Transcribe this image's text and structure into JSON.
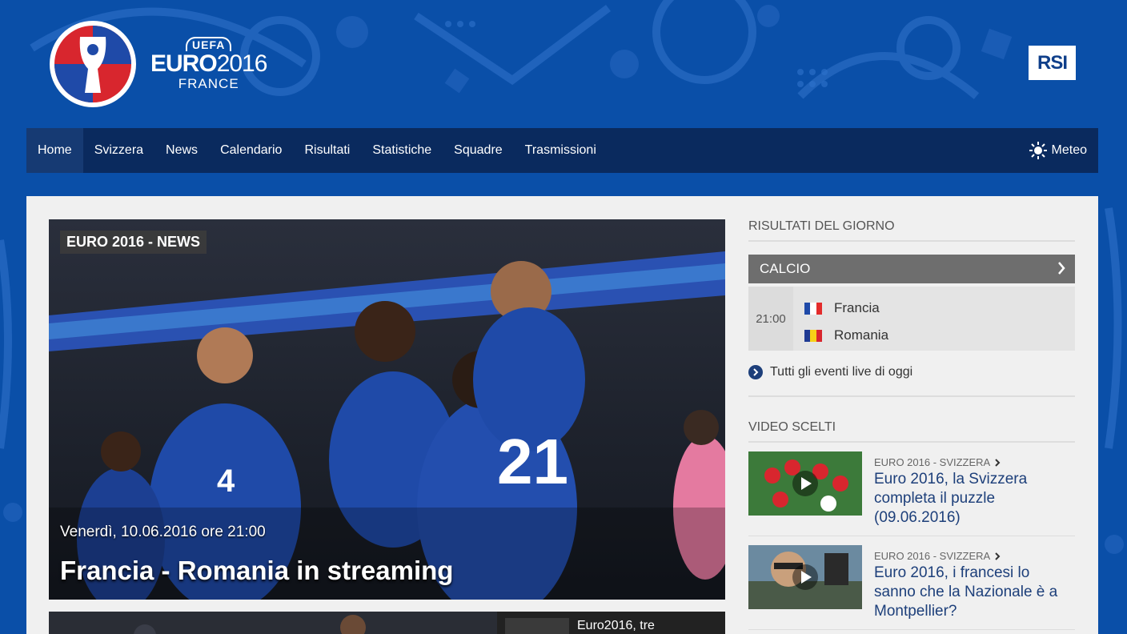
{
  "header": {
    "brand_uefa": "UEFA",
    "brand_euro": "EURO",
    "brand_year": "2016",
    "brand_country": "FRANCE",
    "broadcaster": "RSI"
  },
  "nav": {
    "items": [
      "Home",
      "Svizzera",
      "News",
      "Calendario",
      "Risultati",
      "Statistiche",
      "Squadre",
      "Trasmissioni"
    ],
    "active_index": 0,
    "meteo_label": "Meteo"
  },
  "hero": {
    "tag": "EURO 2016 - NEWS",
    "date": "Venerdì, 10.06.2016 ore 21:00",
    "title": "Francia - Romania in streaming",
    "jersey_number": "21",
    "jersey_number_2": "4"
  },
  "second_story": {
    "title": "Euro2016, tre"
  },
  "sidebar": {
    "results_heading": "RISULTATI DEL GIORNO",
    "sport_label": "CALCIO",
    "match": {
      "time": "21:00",
      "home": "Francia",
      "away": "Romania"
    },
    "live_link": "Tutti gli eventi live di oggi",
    "video_heading": "VIDEO SCELTI",
    "videos": [
      {
        "category": "EURO 2016 - SVIZZERA",
        "title": "Euro 2016, la Svizzera completa il puzzle (09.06.2016)"
      },
      {
        "category": "EURO 2016 - SVIZZERA",
        "title": "Euro 2016, i francesi lo sanno che la Nazionale è a Montpellier?"
      }
    ]
  },
  "colors": {
    "background_blue": "#0a4fa8",
    "nav_dark": "#0a2a5e",
    "panel_grey": "#f0f0f0",
    "link_blue": "#1d3f7a",
    "france_blue": "#1f4aa8"
  }
}
